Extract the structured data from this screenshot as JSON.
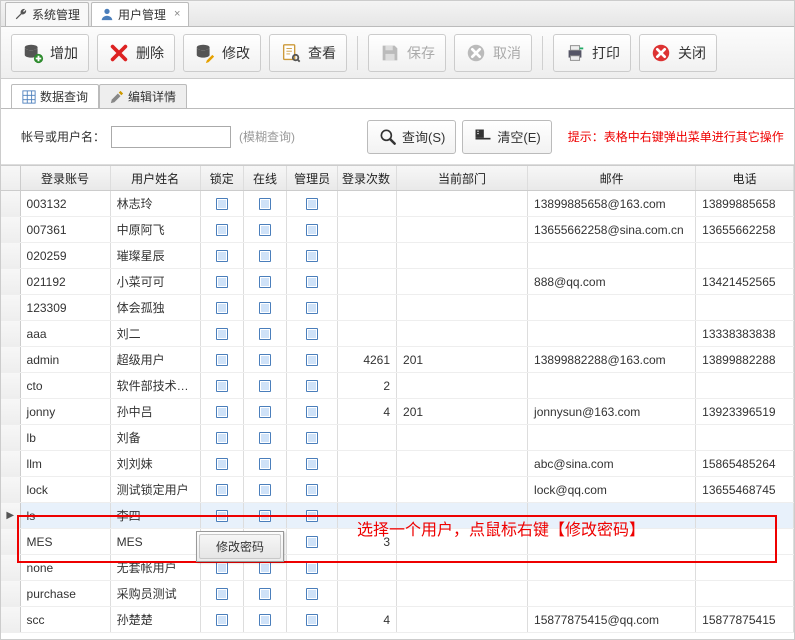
{
  "tabs": [
    {
      "label": "系统管理",
      "closable": false
    },
    {
      "label": "用户管理",
      "closable": true,
      "active": true
    }
  ],
  "toolbar": {
    "add": "增加",
    "delete": "删除",
    "edit": "修改",
    "view": "查看",
    "save": "保存",
    "cancel": "取消",
    "print": "打印",
    "close": "关闭"
  },
  "subtabs": {
    "data_query": "数据查询",
    "edit_detail": "编辑详情"
  },
  "search": {
    "label": "帐号或用户名：",
    "placeholder": "",
    "hint": "(模糊查询)",
    "query_btn": "查询(S)",
    "clear_btn": "清空(E)",
    "tip": "提示：表格中右键弹出菜单进行其它操作"
  },
  "columns": [
    "登录账号",
    "用户姓名",
    "锁定",
    "在线",
    "管理员",
    "登录次数",
    "当前部门",
    "邮件",
    "电话"
  ],
  "rows": [
    {
      "acct": "003132",
      "name": "林志玲",
      "lock": true,
      "online": true,
      "admin": true,
      "logins": "",
      "dept": "",
      "email": "13899885658@163.com",
      "phone": "13899885658"
    },
    {
      "acct": "007361",
      "name": "中原阿飞",
      "lock": true,
      "online": true,
      "admin": true,
      "logins": "",
      "dept": "",
      "email": "13655662258@sina.com.cn",
      "phone": "13655662258"
    },
    {
      "acct": "020259",
      "name": "璀璨星辰",
      "lock": true,
      "online": true,
      "admin": true,
      "logins": "",
      "dept": "",
      "email": "",
      "phone": ""
    },
    {
      "acct": "021192",
      "name": "小菜可可",
      "lock": true,
      "online": true,
      "admin": true,
      "logins": "",
      "dept": "",
      "email": "888@qq.com",
      "phone": "13421452565"
    },
    {
      "acct": "123309",
      "name": "体会孤独",
      "lock": true,
      "online": true,
      "admin": true,
      "logins": "",
      "dept": "",
      "email": "",
      "phone": ""
    },
    {
      "acct": "aaa",
      "name": "刘二",
      "lock": true,
      "online": true,
      "admin": true,
      "logins": "",
      "dept": "",
      "email": "",
      "phone": "13338383838"
    },
    {
      "acct": "admin",
      "name": "超级用户",
      "lock": true,
      "online": true,
      "admin": true,
      "logins": "4261",
      "dept": "201",
      "email": "13899882288@163.com",
      "phone": "13899882288"
    },
    {
      "acct": "cto",
      "name": "软件部技术…",
      "lock": true,
      "online": true,
      "admin": true,
      "logins": "2",
      "dept": "",
      "email": "",
      "phone": ""
    },
    {
      "acct": "jonny",
      "name": "孙中吕",
      "lock": true,
      "online": true,
      "admin": true,
      "logins": "4",
      "dept": "201",
      "email": "jonnysun@163.com",
      "phone": "13923396519"
    },
    {
      "acct": "lb",
      "name": "刘备",
      "lock": true,
      "online": true,
      "admin": true,
      "logins": "",
      "dept": "",
      "email": "",
      "phone": ""
    },
    {
      "acct": "llm",
      "name": "刘刘妹",
      "lock": true,
      "online": true,
      "admin": true,
      "logins": "",
      "dept": "",
      "email": "abc@sina.com",
      "phone": "15865485264"
    },
    {
      "acct": "lock",
      "name": "测试锁定用户",
      "lock": true,
      "online": true,
      "admin": true,
      "logins": "",
      "dept": "",
      "email": "lock@qq.com",
      "phone": "13655468745"
    },
    {
      "acct": "ls",
      "name": "李四",
      "lock": true,
      "online": true,
      "admin": true,
      "logins": "",
      "dept": "",
      "email": "",
      "phone": "",
      "selected": true
    },
    {
      "acct": "MES",
      "name": "MES",
      "lock": true,
      "online": true,
      "admin": true,
      "logins": "3",
      "dept": "",
      "email": "",
      "phone": ""
    },
    {
      "acct": "none",
      "name": "无套帐用户",
      "lock": true,
      "online": true,
      "admin": true,
      "logins": "",
      "dept": "",
      "email": "",
      "phone": ""
    },
    {
      "acct": "purchase",
      "name": "采购员测试",
      "lock": true,
      "online": true,
      "admin": true,
      "logins": "",
      "dept": "",
      "email": "",
      "phone": ""
    },
    {
      "acct": "scc",
      "name": "孙楚楚",
      "lock": true,
      "online": true,
      "admin": true,
      "logins": "4",
      "dept": "",
      "email": "15877875415@qq.com",
      "phone": "15877875415"
    }
  ],
  "context_menu": {
    "change_password": "修改密码"
  },
  "annotation": "选择一个用户，点鼠标右键【修改密码】"
}
